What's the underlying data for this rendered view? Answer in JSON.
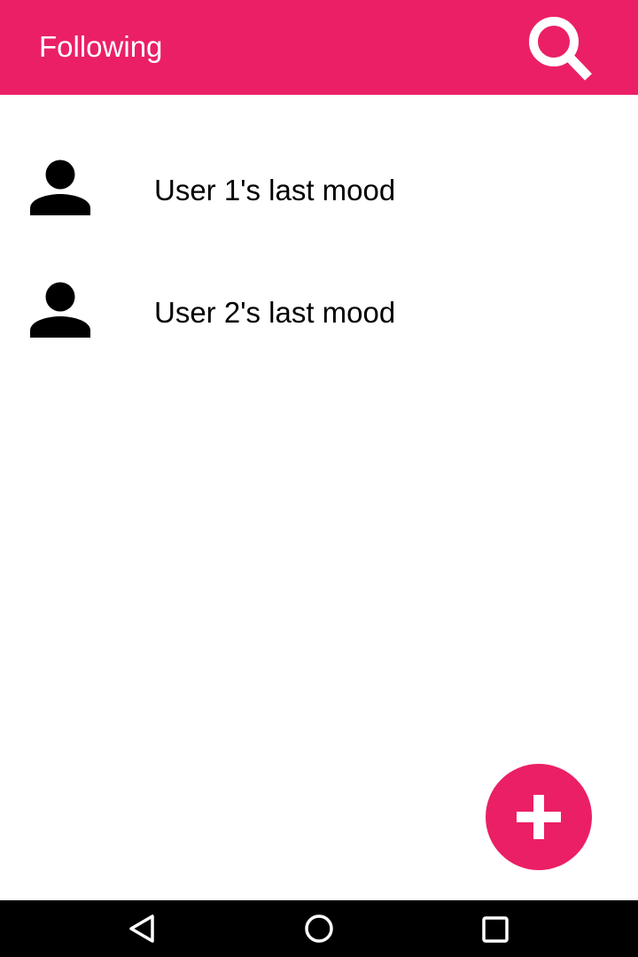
{
  "app_bar": {
    "title": "Following",
    "color": "#eb1f66",
    "search_icon": "search-icon"
  },
  "following_list": [
    {
      "label": "User 1's last mood",
      "icon": "person-icon"
    },
    {
      "label": "User 2's last mood",
      "icon": "person-icon"
    }
  ],
  "fab": {
    "icon": "plus-icon",
    "color": "#eb1f66"
  },
  "nav_bar": {
    "buttons": [
      "back-icon",
      "home-icon",
      "recents-icon"
    ],
    "color": "#000000"
  }
}
